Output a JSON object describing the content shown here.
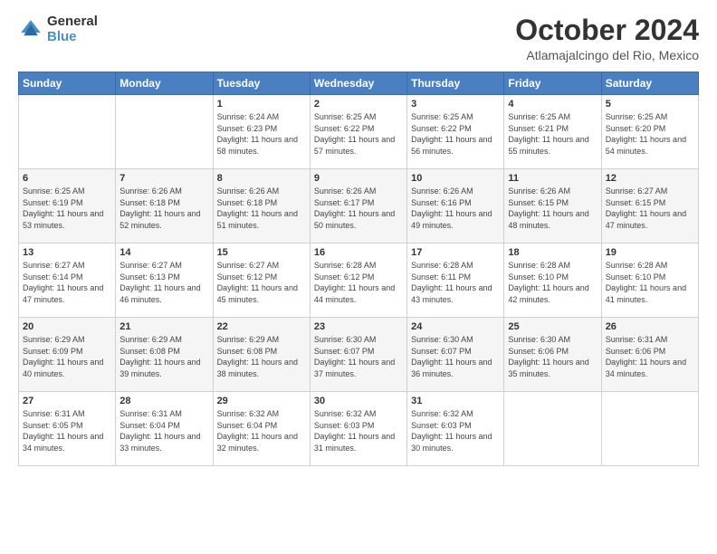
{
  "logo": {
    "general": "General",
    "blue": "Blue"
  },
  "title": "October 2024",
  "location": "Atlamajalcingo del Rio, Mexico",
  "weekdays": [
    "Sunday",
    "Monday",
    "Tuesday",
    "Wednesday",
    "Thursday",
    "Friday",
    "Saturday"
  ],
  "weeks": [
    [
      {
        "day": "",
        "sunrise": "",
        "sunset": "",
        "daylight": ""
      },
      {
        "day": "",
        "sunrise": "",
        "sunset": "",
        "daylight": ""
      },
      {
        "day": "1",
        "sunrise": "Sunrise: 6:24 AM",
        "sunset": "Sunset: 6:23 PM",
        "daylight": "Daylight: 11 hours and 58 minutes."
      },
      {
        "day": "2",
        "sunrise": "Sunrise: 6:25 AM",
        "sunset": "Sunset: 6:22 PM",
        "daylight": "Daylight: 11 hours and 57 minutes."
      },
      {
        "day": "3",
        "sunrise": "Sunrise: 6:25 AM",
        "sunset": "Sunset: 6:22 PM",
        "daylight": "Daylight: 11 hours and 56 minutes."
      },
      {
        "day": "4",
        "sunrise": "Sunrise: 6:25 AM",
        "sunset": "Sunset: 6:21 PM",
        "daylight": "Daylight: 11 hours and 55 minutes."
      },
      {
        "day": "5",
        "sunrise": "Sunrise: 6:25 AM",
        "sunset": "Sunset: 6:20 PM",
        "daylight": "Daylight: 11 hours and 54 minutes."
      }
    ],
    [
      {
        "day": "6",
        "sunrise": "Sunrise: 6:25 AM",
        "sunset": "Sunset: 6:19 PM",
        "daylight": "Daylight: 11 hours and 53 minutes."
      },
      {
        "day": "7",
        "sunrise": "Sunrise: 6:26 AM",
        "sunset": "Sunset: 6:18 PM",
        "daylight": "Daylight: 11 hours and 52 minutes."
      },
      {
        "day": "8",
        "sunrise": "Sunrise: 6:26 AM",
        "sunset": "Sunset: 6:18 PM",
        "daylight": "Daylight: 11 hours and 51 minutes."
      },
      {
        "day": "9",
        "sunrise": "Sunrise: 6:26 AM",
        "sunset": "Sunset: 6:17 PM",
        "daylight": "Daylight: 11 hours and 50 minutes."
      },
      {
        "day": "10",
        "sunrise": "Sunrise: 6:26 AM",
        "sunset": "Sunset: 6:16 PM",
        "daylight": "Daylight: 11 hours and 49 minutes."
      },
      {
        "day": "11",
        "sunrise": "Sunrise: 6:26 AM",
        "sunset": "Sunset: 6:15 PM",
        "daylight": "Daylight: 11 hours and 48 minutes."
      },
      {
        "day": "12",
        "sunrise": "Sunrise: 6:27 AM",
        "sunset": "Sunset: 6:15 PM",
        "daylight": "Daylight: 11 hours and 47 minutes."
      }
    ],
    [
      {
        "day": "13",
        "sunrise": "Sunrise: 6:27 AM",
        "sunset": "Sunset: 6:14 PM",
        "daylight": "Daylight: 11 hours and 47 minutes."
      },
      {
        "day": "14",
        "sunrise": "Sunrise: 6:27 AM",
        "sunset": "Sunset: 6:13 PM",
        "daylight": "Daylight: 11 hours and 46 minutes."
      },
      {
        "day": "15",
        "sunrise": "Sunrise: 6:27 AM",
        "sunset": "Sunset: 6:12 PM",
        "daylight": "Daylight: 11 hours and 45 minutes."
      },
      {
        "day": "16",
        "sunrise": "Sunrise: 6:28 AM",
        "sunset": "Sunset: 6:12 PM",
        "daylight": "Daylight: 11 hours and 44 minutes."
      },
      {
        "day": "17",
        "sunrise": "Sunrise: 6:28 AM",
        "sunset": "Sunset: 6:11 PM",
        "daylight": "Daylight: 11 hours and 43 minutes."
      },
      {
        "day": "18",
        "sunrise": "Sunrise: 6:28 AM",
        "sunset": "Sunset: 6:10 PM",
        "daylight": "Daylight: 11 hours and 42 minutes."
      },
      {
        "day": "19",
        "sunrise": "Sunrise: 6:28 AM",
        "sunset": "Sunset: 6:10 PM",
        "daylight": "Daylight: 11 hours and 41 minutes."
      }
    ],
    [
      {
        "day": "20",
        "sunrise": "Sunrise: 6:29 AM",
        "sunset": "Sunset: 6:09 PM",
        "daylight": "Daylight: 11 hours and 40 minutes."
      },
      {
        "day": "21",
        "sunrise": "Sunrise: 6:29 AM",
        "sunset": "Sunset: 6:08 PM",
        "daylight": "Daylight: 11 hours and 39 minutes."
      },
      {
        "day": "22",
        "sunrise": "Sunrise: 6:29 AM",
        "sunset": "Sunset: 6:08 PM",
        "daylight": "Daylight: 11 hours and 38 minutes."
      },
      {
        "day": "23",
        "sunrise": "Sunrise: 6:30 AM",
        "sunset": "Sunset: 6:07 PM",
        "daylight": "Daylight: 11 hours and 37 minutes."
      },
      {
        "day": "24",
        "sunrise": "Sunrise: 6:30 AM",
        "sunset": "Sunset: 6:07 PM",
        "daylight": "Daylight: 11 hours and 36 minutes."
      },
      {
        "day": "25",
        "sunrise": "Sunrise: 6:30 AM",
        "sunset": "Sunset: 6:06 PM",
        "daylight": "Daylight: 11 hours and 35 minutes."
      },
      {
        "day": "26",
        "sunrise": "Sunrise: 6:31 AM",
        "sunset": "Sunset: 6:06 PM",
        "daylight": "Daylight: 11 hours and 34 minutes."
      }
    ],
    [
      {
        "day": "27",
        "sunrise": "Sunrise: 6:31 AM",
        "sunset": "Sunset: 6:05 PM",
        "daylight": "Daylight: 11 hours and 34 minutes."
      },
      {
        "day": "28",
        "sunrise": "Sunrise: 6:31 AM",
        "sunset": "Sunset: 6:04 PM",
        "daylight": "Daylight: 11 hours and 33 minutes."
      },
      {
        "day": "29",
        "sunrise": "Sunrise: 6:32 AM",
        "sunset": "Sunset: 6:04 PM",
        "daylight": "Daylight: 11 hours and 32 minutes."
      },
      {
        "day": "30",
        "sunrise": "Sunrise: 6:32 AM",
        "sunset": "Sunset: 6:03 PM",
        "daylight": "Daylight: 11 hours and 31 minutes."
      },
      {
        "day": "31",
        "sunrise": "Sunrise: 6:32 AM",
        "sunset": "Sunset: 6:03 PM",
        "daylight": "Daylight: 11 hours and 30 minutes."
      },
      {
        "day": "",
        "sunrise": "",
        "sunset": "",
        "daylight": ""
      },
      {
        "day": "",
        "sunrise": "",
        "sunset": "",
        "daylight": ""
      }
    ]
  ]
}
